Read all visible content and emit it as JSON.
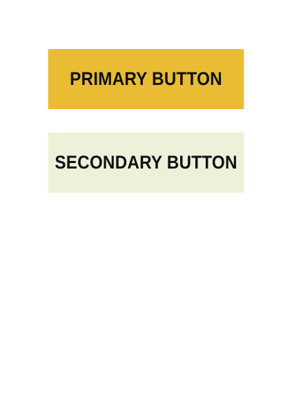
{
  "buttons": {
    "primary": {
      "label": "PRIMARY BUTTON",
      "color": "#e9bc33"
    },
    "secondary": {
      "label": "SECONDARY BUTTON",
      "color": "#eff0da"
    }
  }
}
